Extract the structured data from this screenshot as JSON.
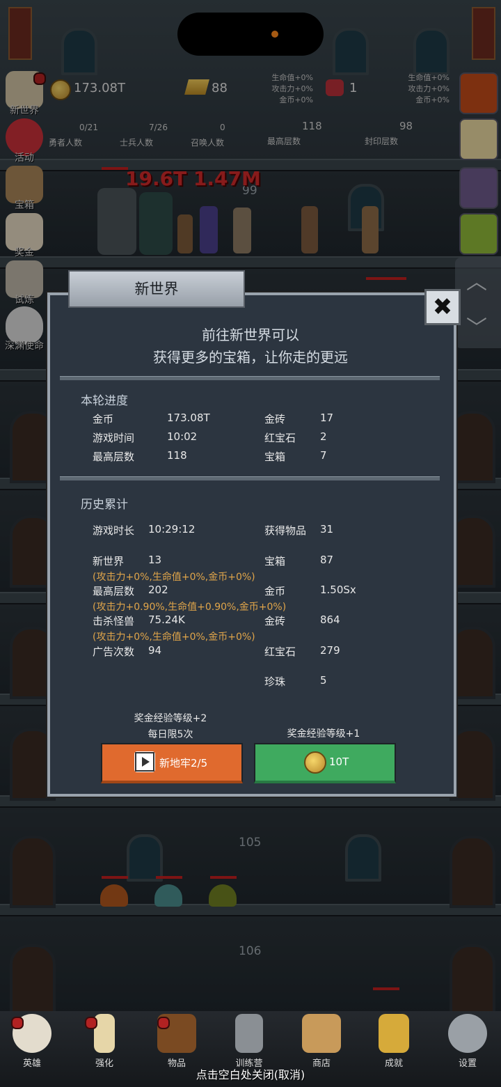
{
  "top_resources": {
    "gold": "173.08T",
    "gold_brick": "88",
    "ruby": "1",
    "gold_brick_bonus": [
      "生命值+0%",
      "攻击力+0%",
      "金币+0%"
    ],
    "ruby_bonus": [
      "生命值+0%",
      "攻击力+0%",
      "金币+0%"
    ]
  },
  "top_stats": [
    {
      "value": "0/21",
      "label": "勇者人数"
    },
    {
      "value": "7/26",
      "label": "士兵人数"
    },
    {
      "value": "0",
      "label": "召唤人数"
    },
    {
      "value": "118",
      "label": "最高层数"
    },
    {
      "value": "98",
      "label": "封印层数"
    }
  ],
  "side_menu": [
    "新世界",
    "活动",
    "宝箱",
    "奖金",
    "试炼",
    "深渊使命"
  ],
  "battle": {
    "damage_text": "19.6T 1.47M",
    "floor_numbers": [
      "99",
      "105",
      "106"
    ]
  },
  "dialog": {
    "title": "新世界",
    "close": "✖",
    "intro_line1": "前往新世界可以",
    "intro_line2": "获得更多的宝箱，让你走的更远",
    "current": {
      "heading": "本轮进度",
      "rows": [
        {
          "l1": "金币",
          "v1": "173.08T",
          "l2": "金砖",
          "v2": "17"
        },
        {
          "l1": "游戏时间",
          "v1": "10:02",
          "l2": "红宝石",
          "v2": "2"
        },
        {
          "l1": "最高层数",
          "v1": "118",
          "l2": "宝箱",
          "v2": "7"
        }
      ]
    },
    "history": {
      "heading": "历史累计",
      "play_time_label": "游戏时长",
      "play_time": "10:29:12",
      "items_label": "获得物品",
      "items": "31",
      "new_world_label": "新世界",
      "new_world": "13",
      "chest_label": "宝箱",
      "chest": "87",
      "bonus1": "(攻击力+0%,生命值+0%,金币+0%)",
      "max_floor_label": "最高层数",
      "max_floor": "202",
      "gold_label": "金币",
      "gold": "1.50Sx",
      "bonus2": "(攻击力+0.90%,生命值+0.90%,金币+0%)",
      "kills_label": "击杀怪兽",
      "kills": "75.24K",
      "brick_label": "金砖",
      "brick": "864",
      "bonus3": "(攻击力+0%,生命值+0%,金币+0%)",
      "ads_label": "广告次数",
      "ads": "94",
      "ruby_label": "红宝石",
      "ruby": "279",
      "pearl_label": "珍珠",
      "pearl": "5"
    },
    "left_note1": "奖金经验等级+2",
    "left_note2": "每日限5次",
    "right_note": "奖金经验等级+1",
    "btn_left": "新地牢2/5",
    "btn_right": "10T"
  },
  "bottom_nav": [
    "英雄",
    "强化",
    "物品",
    "训练营",
    "商店",
    "成就",
    "设置"
  ],
  "footer": "点击空白处关闭(取消)",
  "colors": {
    "orange": "#e06a2e",
    "green": "#3faa5f",
    "bonus": "#e0a54a"
  }
}
